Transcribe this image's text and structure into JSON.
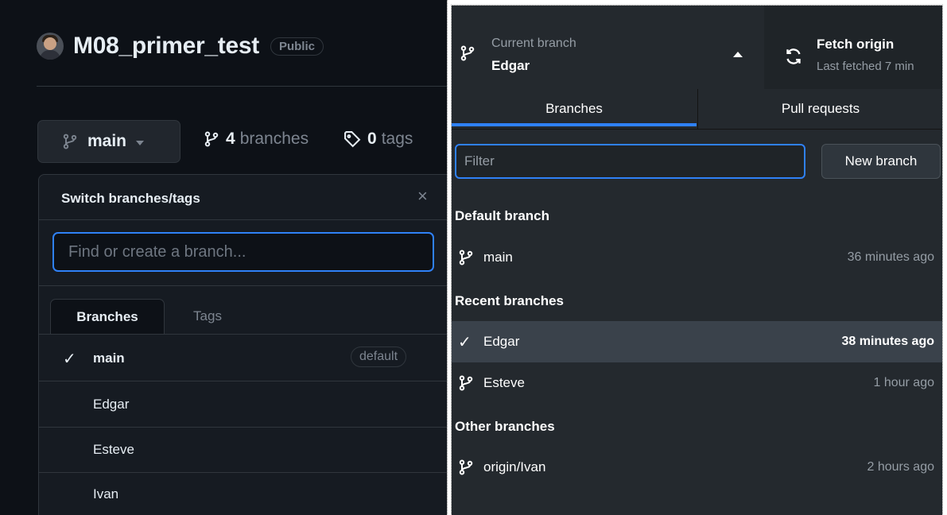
{
  "web": {
    "repo_name": "M08_primer_test",
    "visibility": "Public",
    "branch_button": "main",
    "branches_count": "4",
    "branches_label": "branches",
    "tags_count": "0",
    "tags_label": "tags",
    "dropdown": {
      "title": "Switch branches/tags",
      "close": "×",
      "search_placeholder": "Find or create a branch...",
      "tabs": [
        "Branches",
        "Tags"
      ],
      "current_branch": "main",
      "default_badge": "default",
      "branches": [
        "Edgar",
        "Esteve",
        "Ivan"
      ],
      "check_mark": "✓"
    }
  },
  "desktop": {
    "current_branch_label": "Current branch",
    "current_branch": "Edgar",
    "fetch_label": "Fetch origin",
    "fetch_sub": "Last fetched 7 min",
    "tabs": [
      "Branches",
      "Pull requests"
    ],
    "filter_placeholder": "Filter",
    "new_branch": "New branch",
    "check_mark": "✓",
    "sections": {
      "default": {
        "title": "Default branch",
        "items": [
          {
            "name": "main",
            "time": "36 minutes ago"
          }
        ]
      },
      "recent": {
        "title": "Recent branches",
        "items": [
          {
            "name": "Edgar",
            "time": "38 minutes ago"
          },
          {
            "name": "Esteve",
            "time": "1 hour ago"
          }
        ]
      },
      "other": {
        "title": "Other branches",
        "items": [
          {
            "name": "origin/Ivan",
            "time": "2 hours ago"
          }
        ]
      }
    }
  }
}
